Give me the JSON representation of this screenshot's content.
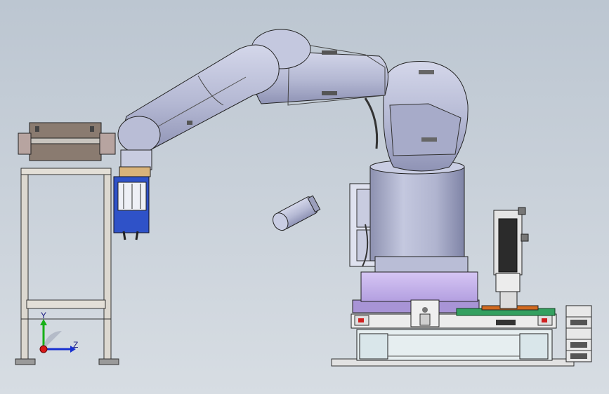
{
  "window": {
    "title": "",
    "view": "cad-3d-viewport"
  },
  "triad": {
    "y_label": "Y",
    "z_label": "Z",
    "x_color": "#d81818",
    "y_color": "#18b018",
    "z_color": "#1830d0"
  },
  "scene": {
    "objects": [
      "robot-arm",
      "robot-base-column",
      "gripper",
      "conveyor-stand",
      "servo-motor-unit",
      "floating-cylinder-part",
      "base-platform",
      "side-rack"
    ]
  },
  "colors": {
    "robot_body": "#b8bcd6",
    "robot_shadow": "#8a8fb2",
    "platform_purple": "#c8b4ec",
    "green_plate": "#34a060",
    "gripper_blue": "#2f52c8",
    "frame_gray": "#d8d4cc",
    "background": "#c8d0d9"
  }
}
